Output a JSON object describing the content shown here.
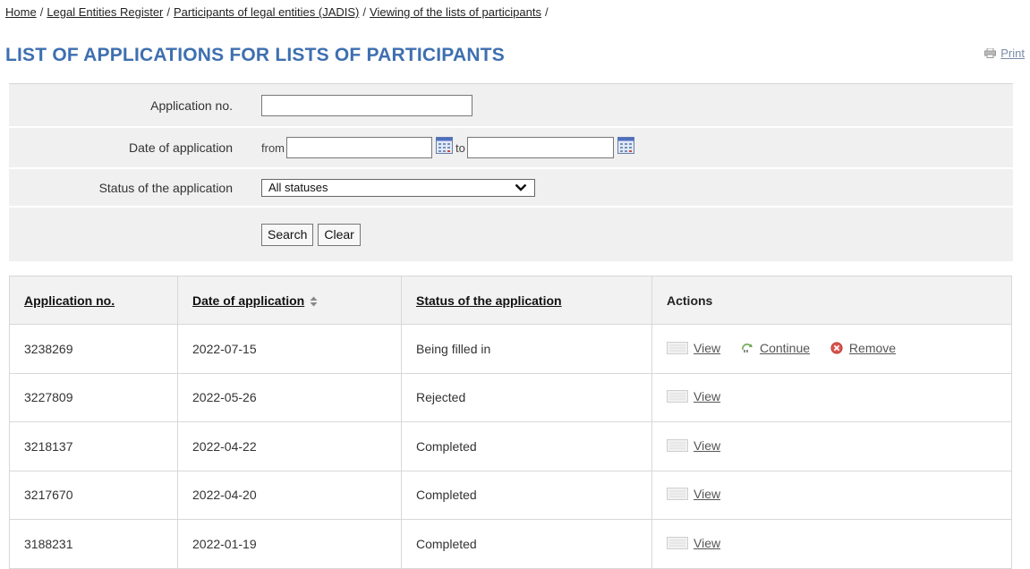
{
  "breadcrumb": {
    "items": [
      "Home",
      "Legal Entities Register",
      "Participants of legal entities (JADIS)",
      "Viewing of the lists of participants"
    ],
    "separator": "/"
  },
  "page": {
    "title": "LIST OF APPLICATIONS FOR LISTS OF PARTICIPANTS",
    "print_label": "Print"
  },
  "filter": {
    "application_no_label": "Application no.",
    "application_no_value": "",
    "date_label": "Date of application",
    "from_label": "from",
    "to_label": "to",
    "date_from_value": "",
    "date_to_value": "",
    "status_label": "Status of the application",
    "status_selected": "All statuses",
    "search_label": "Search",
    "clear_label": "Clear"
  },
  "table": {
    "headers": [
      "Application no.",
      "Date of application",
      "Status of the application",
      "Actions"
    ],
    "rows": [
      {
        "no": "3238269",
        "date": "2022-07-15",
        "status": "Being filled in",
        "actions": [
          "View",
          "Continue",
          "Remove"
        ]
      },
      {
        "no": "3227809",
        "date": "2022-05-26",
        "status": "Rejected",
        "actions": [
          "View"
        ]
      },
      {
        "no": "3218137",
        "date": "2022-04-22",
        "status": "Completed",
        "actions": [
          "View"
        ]
      },
      {
        "no": "3217670",
        "date": "2022-04-20",
        "status": "Completed",
        "actions": [
          "View"
        ]
      },
      {
        "no": "3188231",
        "date": "2022-01-19",
        "status": "Completed",
        "actions": [
          "View"
        ]
      }
    ]
  },
  "colors": {
    "title": "#3e6fb0",
    "filter_bg": "#f0f0f0",
    "header_bg": "#f2f2f2",
    "remove_icon": "#d9534f",
    "continue_icon": "#6aa84f"
  },
  "icons": {
    "print": "printer-icon",
    "calendar": "calendar-icon",
    "sort": "sort-icon",
    "view": "view-icon",
    "continue": "continue-icon",
    "remove": "remove-icon"
  }
}
